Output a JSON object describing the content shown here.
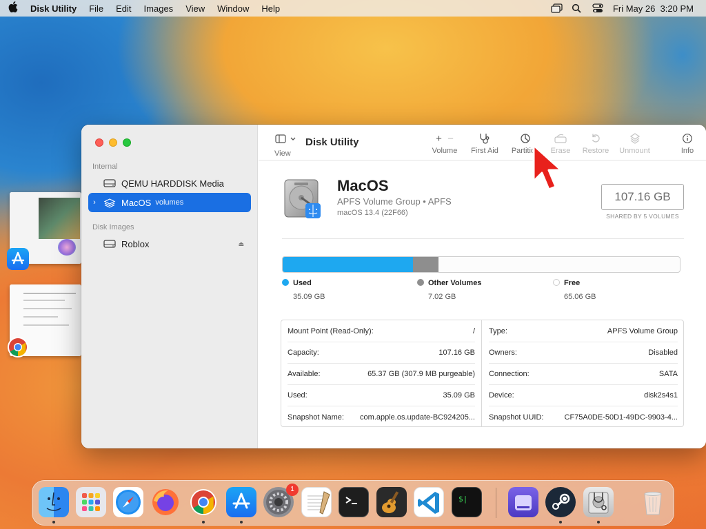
{
  "menubar": {
    "app_name": "Disk Utility",
    "menus": [
      "File",
      "Edit",
      "Images",
      "View",
      "Window",
      "Help"
    ],
    "datetime": "Fri May 26  3:20 PM"
  },
  "sidebar": {
    "internal_header": "Internal",
    "disk_images_header": "Disk Images",
    "items": [
      {
        "label": "QEMU HARDDISK Media"
      },
      {
        "label": "MacOS",
        "sublabel": "volumes"
      },
      {
        "label": "Roblox"
      }
    ]
  },
  "toolbar": {
    "view_label": "View",
    "title": "Disk Utility",
    "volume_label": "Volume",
    "first_aid_label": "First Aid",
    "partition_label": "Partition",
    "erase_label": "Erase",
    "restore_label": "Restore",
    "unmount_label": "Unmount",
    "info_label": "Info"
  },
  "volume": {
    "name": "MacOS",
    "type_line": "APFS Volume Group • APFS",
    "os_line": "macOS 13.4 (22F66)",
    "size": "107.16 GB",
    "size_note": "SHARED BY 5 VOLUMES"
  },
  "usage": {
    "used": {
      "label": "Used",
      "value": "35.09 GB",
      "fraction": 0.3275,
      "color": "#1ea8f0"
    },
    "other": {
      "label": "Other Volumes",
      "value": "7.02 GB",
      "fraction": 0.0655,
      "color": "#8e8e8e"
    },
    "free": {
      "label": "Free",
      "value": "65.06 GB",
      "color": "#ffffff"
    }
  },
  "info": {
    "left": [
      {
        "key": "Mount Point (Read-Only):",
        "value": "/"
      },
      {
        "key": "Capacity:",
        "value": "107.16 GB"
      },
      {
        "key": "Available:",
        "value": "65.37 GB (307.9 MB purgeable)"
      },
      {
        "key": "Used:",
        "value": "35.09 GB"
      },
      {
        "key": "Snapshot Name:",
        "value": "com.apple.os.update-BC924205..."
      }
    ],
    "right": [
      {
        "key": "Type:",
        "value": "APFS Volume Group"
      },
      {
        "key": "Owners:",
        "value": "Disabled"
      },
      {
        "key": "Connection:",
        "value": "SATA"
      },
      {
        "key": "Device:",
        "value": "disk2s4s1"
      },
      {
        "key": "Snapshot UUID:",
        "value": "CF75A0DE-50D1-49DC-9903-4..."
      }
    ]
  },
  "dock": {
    "apps": [
      "finder",
      "launchpad",
      "safari",
      "firefox",
      "chrome",
      "app-store",
      "system-settings",
      "textedit",
      "terminal",
      "garageband",
      "vscode",
      "terminal-green",
      "storage",
      "steam",
      "disk-utility",
      "trash"
    ],
    "settings_badge": "1"
  }
}
